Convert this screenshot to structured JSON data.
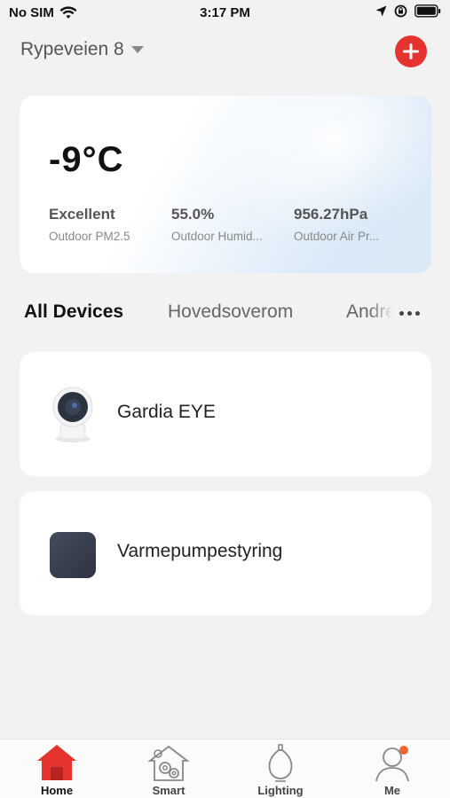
{
  "status_bar": {
    "carrier": "No SIM",
    "time": "3:17 PM"
  },
  "header": {
    "home_name": "Rypeveien 8"
  },
  "weather": {
    "temperature": "-9°C",
    "metrics": [
      {
        "value": "Excellent",
        "label": "Outdoor PM2.5"
      },
      {
        "value": "55.0%",
        "label": "Outdoor Humid..."
      },
      {
        "value": "956.27hPa",
        "label": "Outdoor Air Pr..."
      }
    ]
  },
  "room_tabs": [
    "All Devices",
    "Hovedsoverom",
    "Andre"
  ],
  "devices": [
    {
      "name": "Gardia EYE",
      "icon": "camera-icon"
    },
    {
      "name": "Varmepumpestyring",
      "icon": "hub-device-icon"
    }
  ],
  "bottom_nav": [
    {
      "label": "Home",
      "icon": "home-icon",
      "active": true
    },
    {
      "label": "Smart",
      "icon": "smart-scene-icon",
      "active": false
    },
    {
      "label": "Lighting",
      "icon": "lightbulb-icon",
      "active": false
    },
    {
      "label": "Me",
      "icon": "profile-icon",
      "active": false
    }
  ],
  "colors": {
    "accent": "#e5332f",
    "background": "#f2f2f2"
  }
}
